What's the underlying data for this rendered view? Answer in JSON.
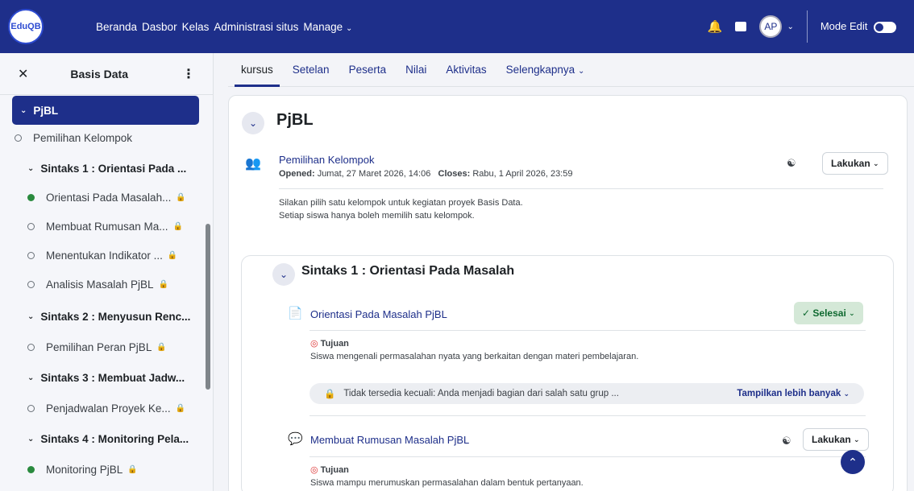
{
  "navbar": {
    "logo_text": "EduQB",
    "links": [
      "Beranda",
      "Dasbor",
      "Kelas",
      "Administrasi situs"
    ],
    "manage_label": "Manage",
    "avatar_initials": "AP",
    "mode_edit_label": "Mode Edit"
  },
  "sidebar": {
    "title": "Basis Data",
    "active_section": "PjBL",
    "items": [
      {
        "type": "circle",
        "label": "Pemilihan Kelompok"
      },
      {
        "type": "section",
        "label": "Sintaks 1 : Orientasi Pada ..."
      },
      {
        "type": "done",
        "label": "Orientasi Pada Masalah..."
      },
      {
        "type": "circle",
        "label": "Membuat Rumusan Ma..."
      },
      {
        "type": "circle",
        "label": "Menentukan Indikator ..."
      },
      {
        "type": "circle",
        "label": "Analisis Masalah PjBL"
      },
      {
        "type": "section",
        "label": "Sintaks 2 : Menyusun Renc..."
      },
      {
        "type": "circle",
        "label": "Pemilihan Peran PjBL"
      },
      {
        "type": "section",
        "label": "Sintaks 3 : Membuat Jadw..."
      },
      {
        "type": "circle",
        "label": "Penjadwalan Proyek Ke..."
      },
      {
        "type": "section",
        "label": "Sintaks 4 : Monitoring Pela..."
      },
      {
        "type": "done",
        "label": "Monitoring PjBL"
      }
    ]
  },
  "tabs": [
    "kursus",
    "Setelan",
    "Peserta",
    "Nilai",
    "Aktivitas",
    "Selengkapnya"
  ],
  "main": {
    "section_title": "PjBL",
    "activity1": {
      "title": "Pemilihan Kelompok",
      "opened_label": "Opened:",
      "opened_value": "Jumat, 27 Maret 2026, 14:06",
      "closes_label": "Closes:",
      "closes_value": "Rabu, 1 April 2026, 23:59",
      "button": "Lakukan",
      "desc_line1": "Silakan pilih satu kelompok untuk kegiatan proyek Basis Data.",
      "desc_line2": "Setiap siswa hanya boleh memilih satu kelompok."
    },
    "subsection_title": "Sintaks 1 : Orientasi Pada Masalah",
    "activity2": {
      "title": "Orientasi Pada Masalah PjBL",
      "status_button": "Selesai",
      "goal_label": "Tujuan",
      "goal_text": "Siswa mengenali permasalahan nyata yang berkaitan dengan materi pembelajaran.",
      "restriction": "Tidak tersedia kecuali: Anda menjadi bagian dari salah satu grup ...",
      "show_more": "Tampilkan lebih banyak"
    },
    "activity3": {
      "title": "Membuat Rumusan Masalah PjBL",
      "button": "Lakukan",
      "goal_label": "Tujuan",
      "goal_text": "Siswa mampu merumuskan permasalahan dalam bentuk pertanyaan."
    }
  }
}
